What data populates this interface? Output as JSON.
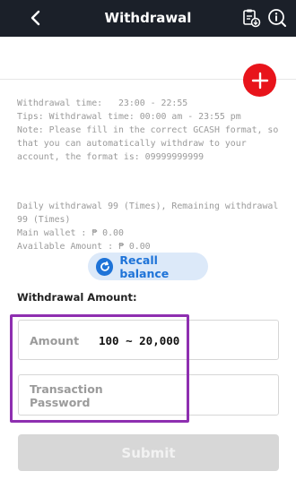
{
  "header": {
    "title": "Withdrawal",
    "back_icon": "chevron-left-icon",
    "records_icon": "clipboard-download-icon",
    "help_icon": "info-search-icon"
  },
  "add_button": {
    "icon": "plus-icon",
    "color": "#e8141b"
  },
  "info": {
    "time": "Withdrawal time:   23:00 - 22:55",
    "tips": "Tips: Withdrawal time: 00:00 am - 23:55 pm",
    "note": "Note: Please fill in the correct GCASH format, so that you can automatically withdraw to your account, the format is: 09999999999",
    "daily": "Daily withdrawal 99 (Times), Remaining withdrawal 99 (Times)",
    "main_wallet": "Main wallet : ₱ 0.00",
    "available": "Available Amount : ₱ 0.00"
  },
  "recall": {
    "label": "Recall balance",
    "icon": "refresh-icon"
  },
  "form": {
    "amount_label": "Withdrawal Amount:",
    "amount_placeholder": "Amount",
    "amount_range": "100 ~ 20,000",
    "password_placeholder": "Transaction Password",
    "submit_label": "Submit"
  },
  "colors": {
    "header_bg": "#1b2029",
    "accent_blue": "#1e73d8",
    "highlight": "#8e2fb0"
  }
}
